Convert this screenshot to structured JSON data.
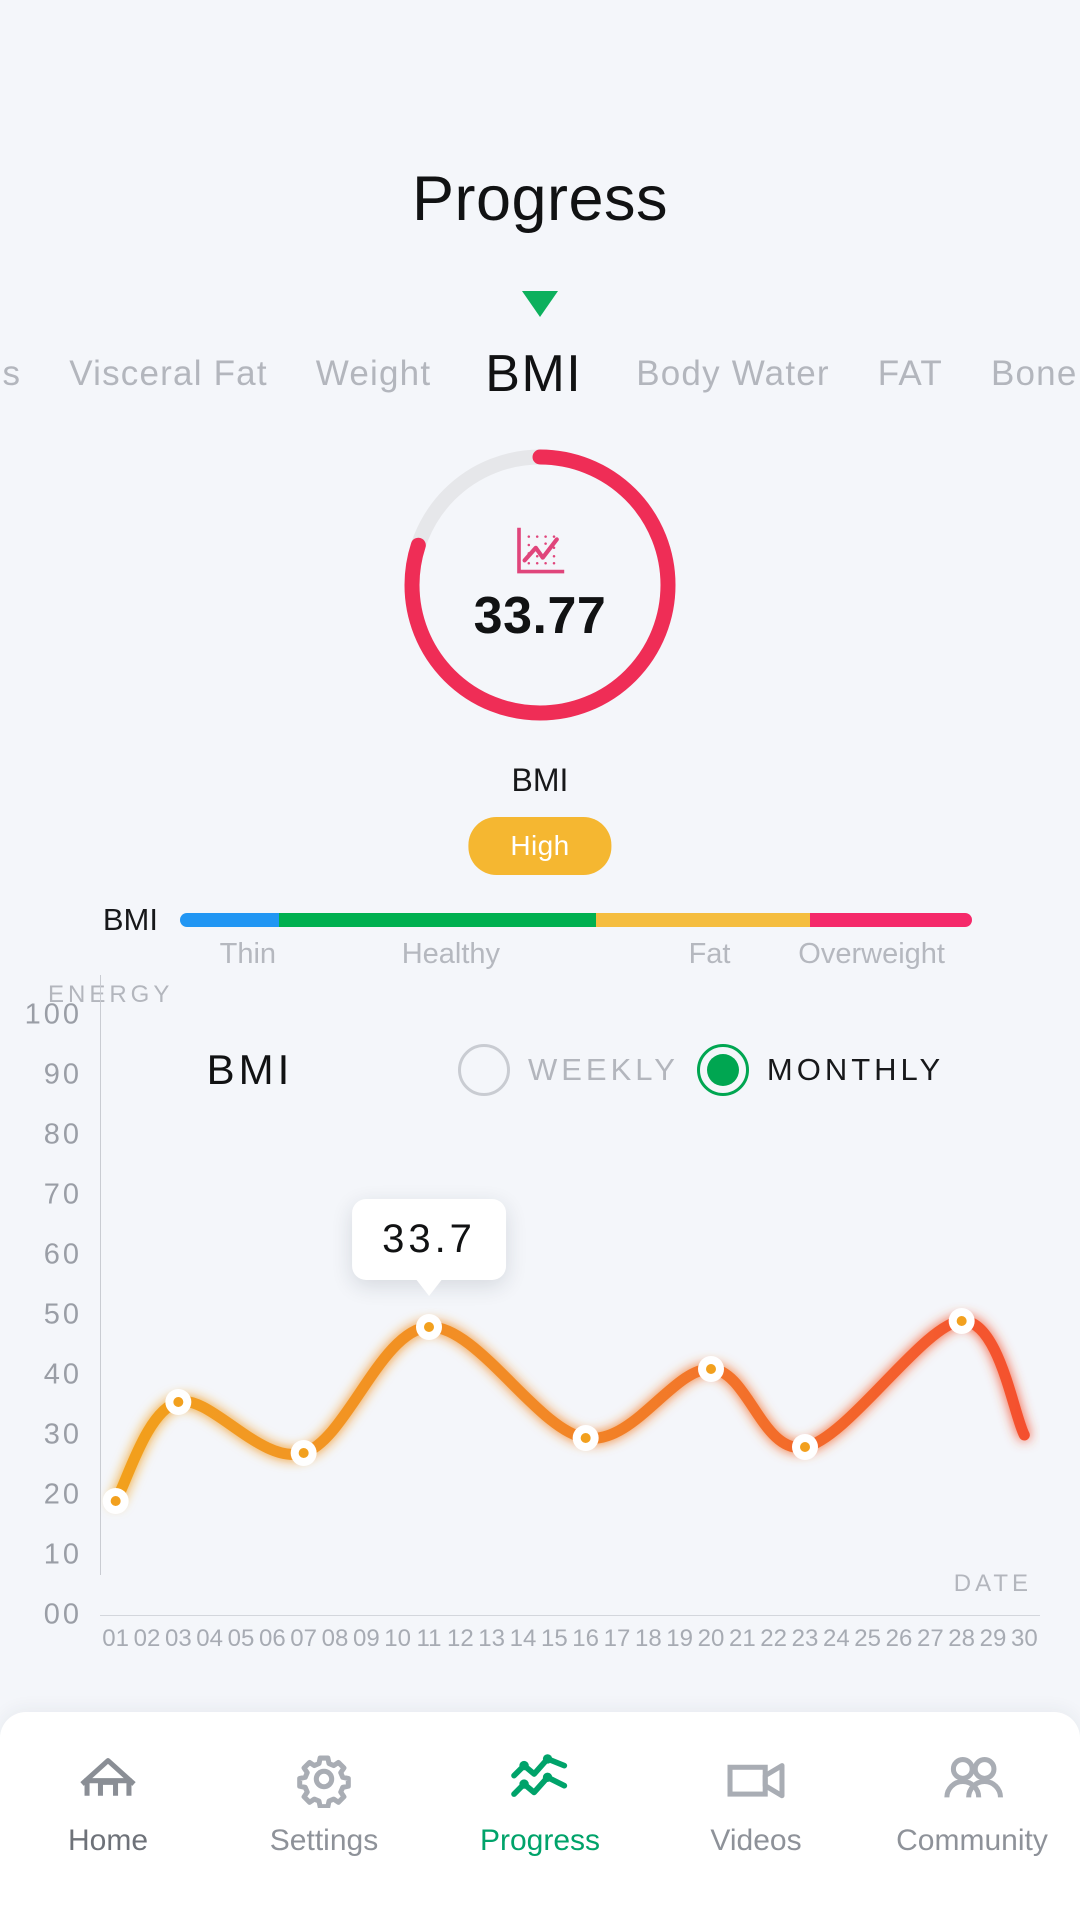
{
  "header": {
    "title": "Progress"
  },
  "metric_tabs": {
    "items": [
      {
        "label": "s",
        "active": false
      },
      {
        "label": "Visceral Fat",
        "active": false
      },
      {
        "label": "Weight",
        "active": false
      },
      {
        "label": "BMI",
        "active": true
      },
      {
        "label": "Body Water",
        "active": false
      },
      {
        "label": "FAT",
        "active": false
      },
      {
        "label": "Bone",
        "active": false
      }
    ],
    "caret_color": "#0cb05d"
  },
  "gauge": {
    "value": "33.77",
    "label": "BMI",
    "status": "High",
    "status_color": "#f5b731",
    "arc_color": "#ef2d56",
    "track_color": "#e6e7ea",
    "percent": 80,
    "icon": "line-chart-icon"
  },
  "range": {
    "title": "BMI",
    "segments": [
      {
        "label": "Thin",
        "color": "#2196f3",
        "width_pct": 12.5
      },
      {
        "label": "Healthy",
        "color": "#00b050",
        "width_pct": 40.0
      },
      {
        "label": "Fat",
        "color": "#f5bd3f",
        "width_pct": 27.0
      },
      {
        "label": "Overweight",
        "color": "#f5296a",
        "width_pct": 20.5
      }
    ],
    "label_positions_pct": [
      6.2,
      32.5,
      66.0,
      87.0
    ]
  },
  "chart_panel": {
    "title": "BMI",
    "periods": [
      {
        "label": "WEEKLY",
        "selected": false
      },
      {
        "label": "MONTHLY",
        "selected": true
      }
    ],
    "selected_color": "#00a651",
    "tooltip": {
      "text": "33.7",
      "day": "11"
    }
  },
  "chart_data": {
    "type": "line",
    "title": "BMI",
    "xlabel": "DATE",
    "ylabel": "ENERGY",
    "ylim": [
      0,
      100
    ],
    "ytick_labels": [
      "100",
      "90",
      "80",
      "70",
      "60",
      "50",
      "40",
      "30",
      "20",
      "10",
      "00"
    ],
    "yticks": [
      100,
      90,
      80,
      70,
      60,
      50,
      40,
      30,
      20,
      10,
      0
    ],
    "categories": [
      "01",
      "02",
      "03",
      "04",
      "05",
      "06",
      "07",
      "08",
      "09",
      "10",
      "11",
      "12",
      "13",
      "14",
      "15",
      "16",
      "17",
      "18",
      "19",
      "20",
      "21",
      "22",
      "23",
      "24",
      "25",
      "26",
      "27",
      "28",
      "29",
      "30"
    ],
    "grid": false,
    "legend": "none",
    "line_gradient": [
      "#f2a01e",
      "#f4502f"
    ],
    "marker_fill": "#ffffff",
    "marker_dot": "#f2a01e",
    "points": [
      {
        "x": "01",
        "y": 19
      },
      {
        "x": "03",
        "y": 35.5
      },
      {
        "x": "07",
        "y": 27
      },
      {
        "x": "11",
        "y": 48
      },
      {
        "x": "16",
        "y": 29.5
      },
      {
        "x": "20",
        "y": 41
      },
      {
        "x": "23",
        "y": 28
      },
      {
        "x": "28",
        "y": 49
      },
      {
        "x": "30",
        "y": 30
      }
    ],
    "values": [
      19,
      35.5,
      27,
      48,
      29.5,
      41,
      28,
      49,
      30
    ],
    "annotations": [
      {
        "text": "33.7",
        "at_x": "11"
      }
    ]
  },
  "bottom_nav": {
    "items": [
      {
        "label": "Home",
        "icon": "home-icon",
        "active": false
      },
      {
        "label": "Settings",
        "icon": "gear-icon",
        "active": false
      },
      {
        "label": "Progress",
        "icon": "progress-chart-icon",
        "active": true
      },
      {
        "label": "Videos",
        "icon": "video-camera-icon",
        "active": false
      },
      {
        "label": "Community",
        "icon": "people-icon",
        "active": false
      }
    ],
    "active_color": "#00a36a"
  }
}
